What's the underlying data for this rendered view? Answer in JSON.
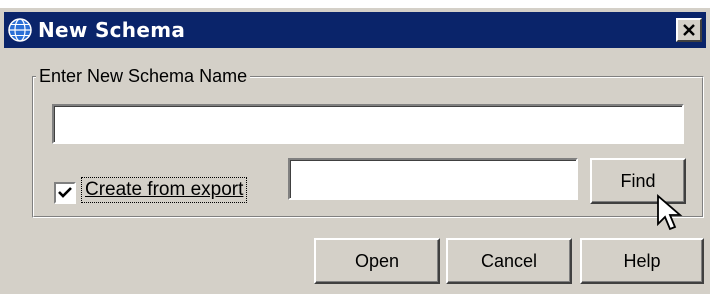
{
  "window": {
    "title": "New Schema",
    "icon": "globe-icon",
    "close_icon": "close-icon"
  },
  "group": {
    "legend": "Enter New Schema Name"
  },
  "schema_name_field": {
    "value": ""
  },
  "create_from_export": {
    "label": "Create from export",
    "checked": true
  },
  "export_path_field": {
    "value": ""
  },
  "buttons": {
    "find": "Find",
    "open": "Open",
    "cancel": "Cancel",
    "help": "Help"
  },
  "colors": {
    "titlebar": "#0a246a",
    "dialog": "#d4d0c8"
  }
}
